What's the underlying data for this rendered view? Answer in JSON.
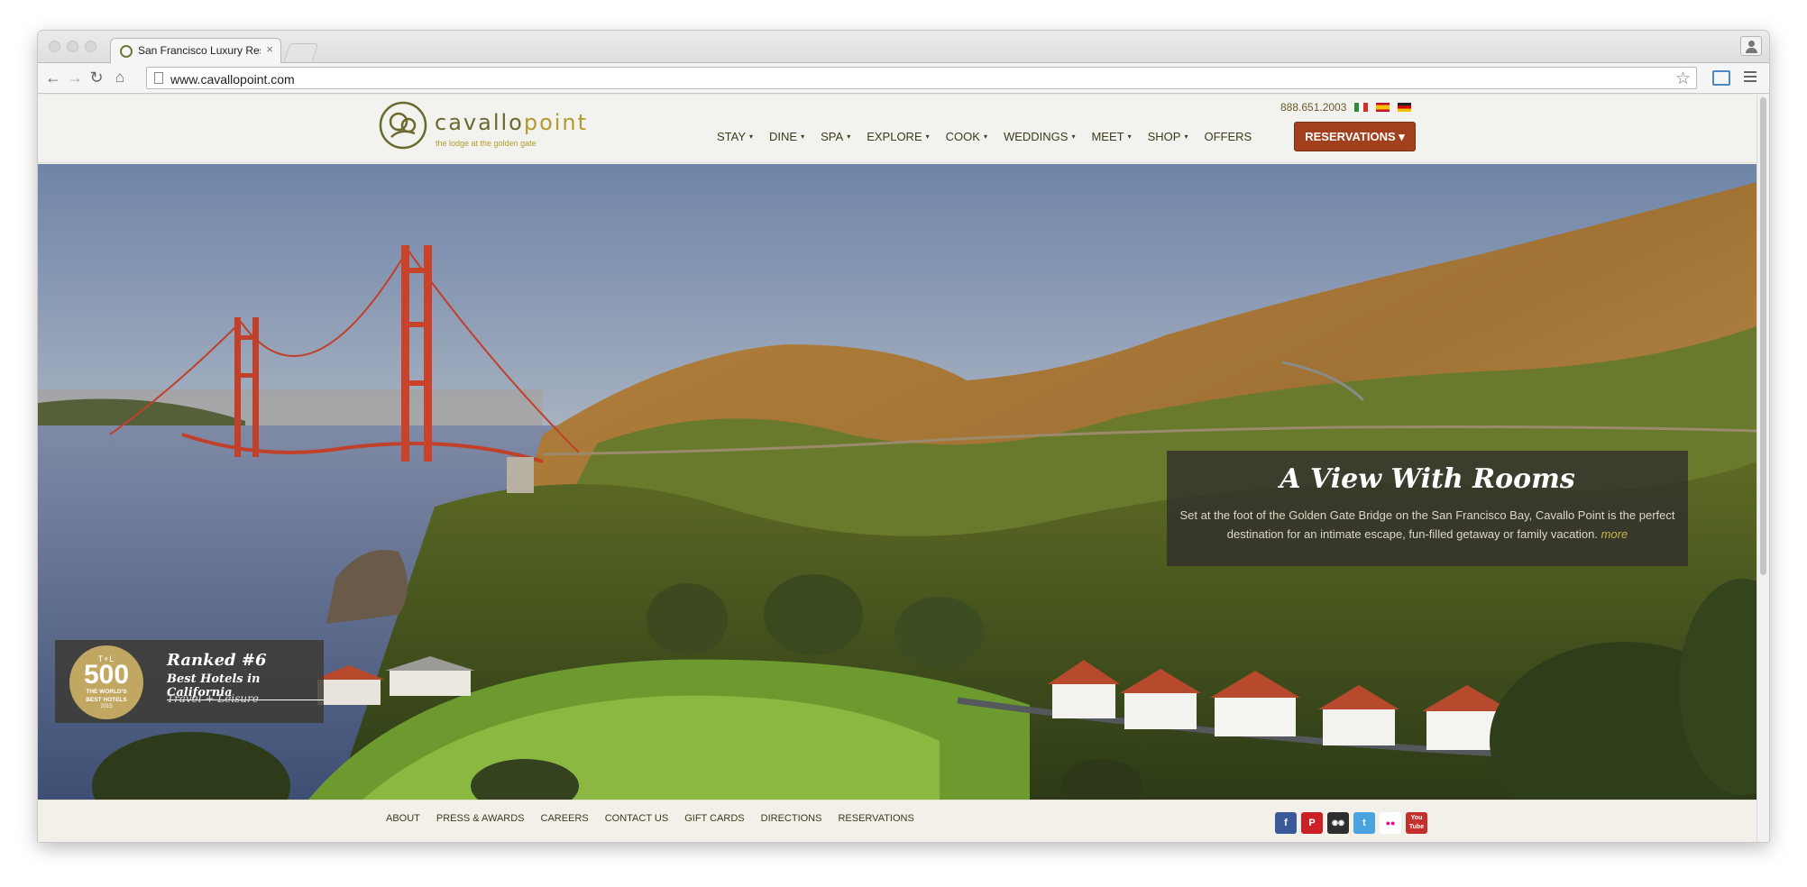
{
  "browser": {
    "tab_title": "San Francisco Luxury Reso",
    "tab_close": "×",
    "url": "www.cavallopoint.com",
    "icons": [
      "back-icon",
      "forward-icon",
      "reload-icon",
      "home-icon",
      "page-icon",
      "bookmark-star-icon",
      "cast-icon",
      "menu-icon",
      "profile-icon"
    ]
  },
  "site": {
    "logo_cavallo": "cavallo",
    "logo_point": "point",
    "logo_tagline": "the lodge at the golden gate",
    "phone": "888.651.2003",
    "flags": [
      "flag-italy-icon",
      "flag-spain-icon",
      "flag-germany-icon"
    ],
    "nav": [
      {
        "label": "STAY",
        "caret": "▾"
      },
      {
        "label": "DINE",
        "caret": "▾"
      },
      {
        "label": "SPA",
        "caret": "▾"
      },
      {
        "label": "EXPLORE",
        "caret": "▾"
      },
      {
        "label": "COOK",
        "caret": "▾"
      },
      {
        "label": "WEDDINGS",
        "caret": "▾"
      },
      {
        "label": "MEET",
        "caret": "▾"
      },
      {
        "label": "SHOP",
        "caret": "▾"
      },
      {
        "label": "OFFERS",
        "caret": ""
      }
    ],
    "reservations_button": "RESERVATIONS ▾",
    "caption": {
      "title": "A View With Rooms",
      "text": "Set at the foot of the Golden Gate Bridge on the San Francisco Bay, Cavallo Point is the perfect destination for an intimate escape, fun-filled getaway or family vacation.",
      "more": "more"
    },
    "award": {
      "seal_top": "T+L",
      "seal_number": "500",
      "seal_line1": "THE WORLD'S",
      "seal_line2": "BEST HOTELS",
      "seal_year": "2015",
      "rank": "Ranked #6",
      "title": "Best Hotels in California",
      "source": "Travel + Leisure"
    },
    "footer_links": [
      "ABOUT",
      "PRESS & AWARDS",
      "CAREERS",
      "CONTACT US",
      "GIFT CARDS",
      "DIRECTIONS",
      "RESERVATIONS"
    ],
    "social": [
      {
        "name": "facebook-icon",
        "glyph": "f",
        "color": "#3b5998"
      },
      {
        "name": "pinterest-icon",
        "glyph": "P",
        "color": "#cb2027"
      },
      {
        "name": "tripadvisor-icon",
        "glyph": "◉◉",
        "color": "#2e2e2e"
      },
      {
        "name": "twitter-icon",
        "glyph": "t",
        "color": "#4aa3df"
      },
      {
        "name": "flickr-icon",
        "glyph": "●●",
        "color": "#ffffff"
      },
      {
        "name": "youtube-icon",
        "glyph": "You Tube",
        "color": "#c4302b"
      }
    ]
  },
  "colors": {
    "accent": "#a23f1c",
    "logo_green": "#6b6a2e",
    "logo_gold": "#b49a2e",
    "nav_text": "#3e3a1c"
  }
}
